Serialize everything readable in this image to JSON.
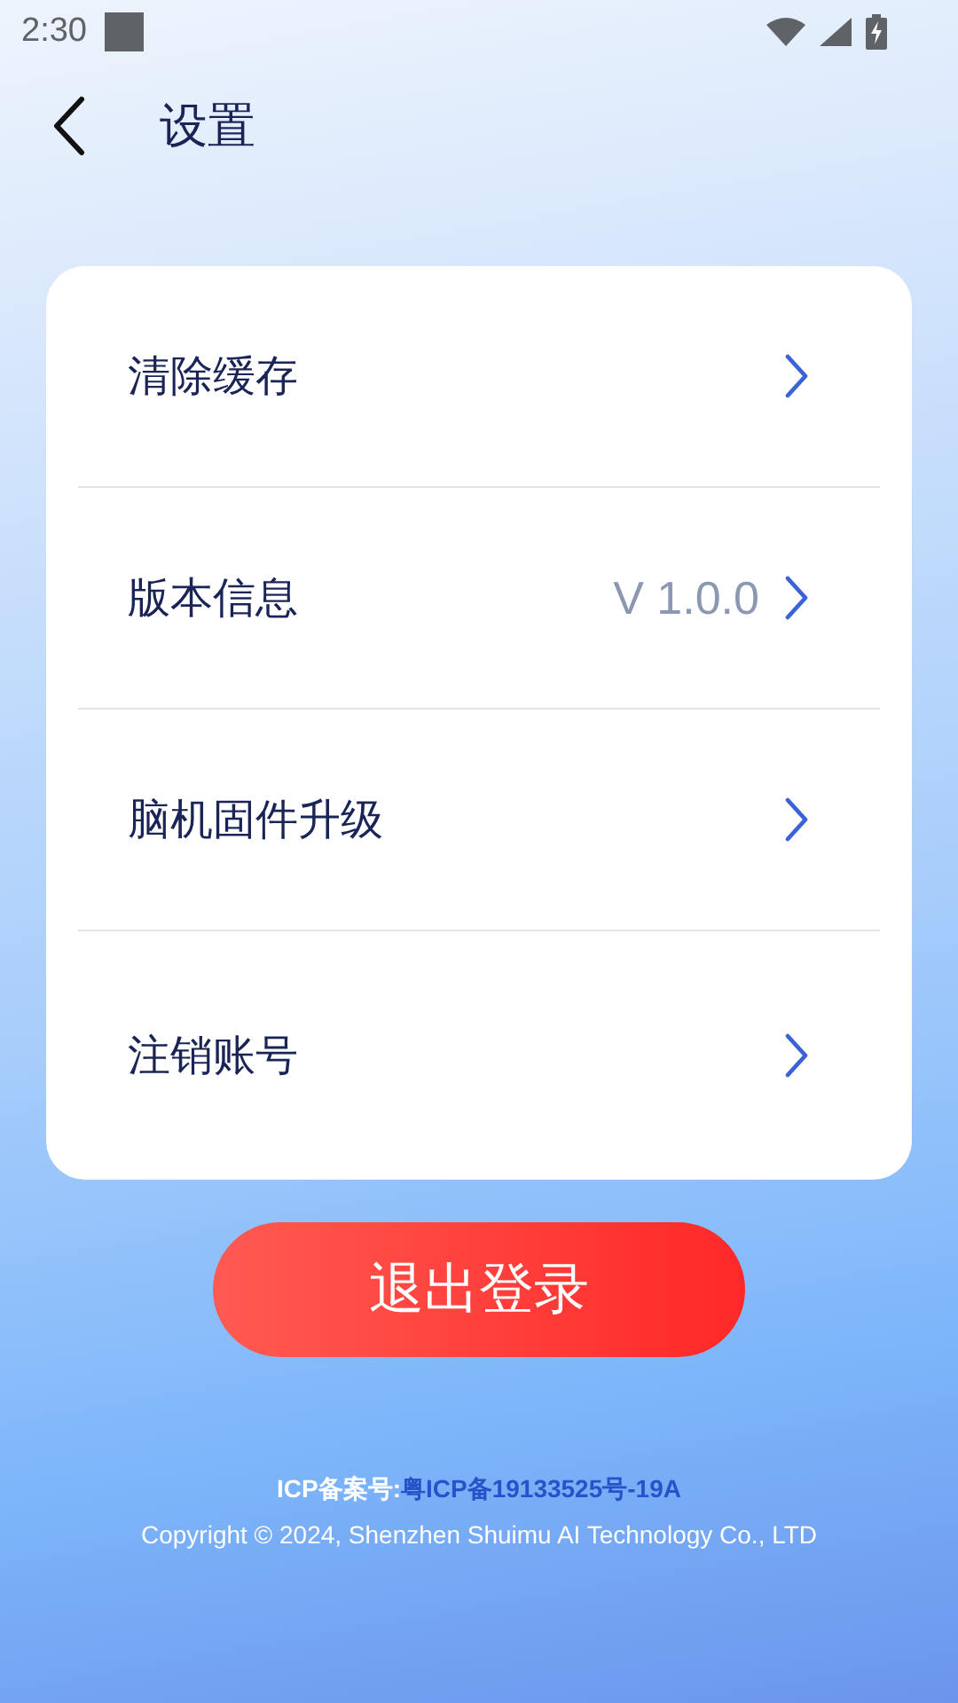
{
  "status_bar": {
    "time": "2:30"
  },
  "header": {
    "title": "设置"
  },
  "settings": [
    {
      "label": "清除缓存"
    },
    {
      "label": "版本信息",
      "value": "V 1.0.0"
    },
    {
      "label": "脑机固件升级"
    },
    {
      "label": "注销账号"
    }
  ],
  "logout_button": "退出登录",
  "footer": {
    "icp_label": "ICP备案号:",
    "icp_number": "粤ICP备19133525号-19A",
    "copyright": "Copyright © 2024, Shenzhen Shuimu AI Technology Co., LTD"
  }
}
